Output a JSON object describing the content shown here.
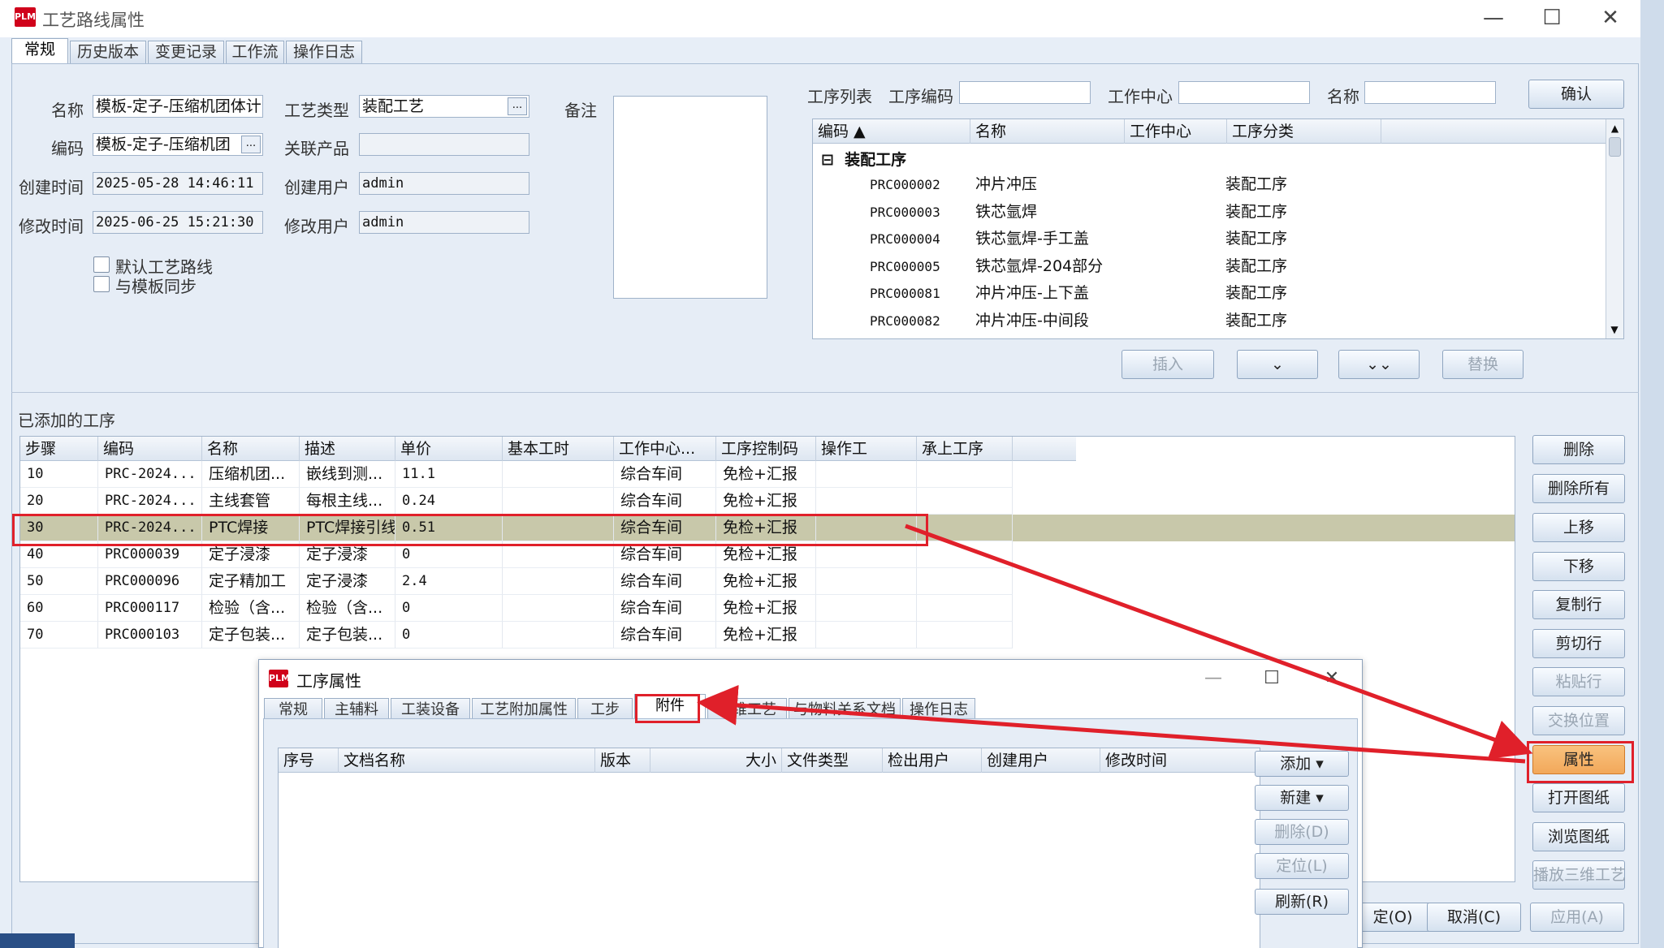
{
  "window": {
    "title": "工艺路线属性"
  },
  "tabs": [
    "常规",
    "历史版本",
    "变更记录",
    "工作流",
    "操作日志"
  ],
  "form": {
    "name_label": "名称",
    "name_value": "模板-定子-压缩机团体计",
    "code_label": "编码",
    "code_value": "模板-定子-压缩机团",
    "created_time_label": "创建时间",
    "created_time_value": "2025-05-28 14:46:11",
    "modified_time_label": "修改时间",
    "modified_time_value": "2025-06-25 15:21:30",
    "process_type_label": "工艺类型",
    "process_type_value": "装配工艺",
    "related_product_label": "关联产品",
    "related_product_value": "",
    "created_user_label": "创建用户",
    "created_user_value": "admin",
    "modified_user_label": "修改用户",
    "modified_user_value": "admin",
    "remark_label": "备注",
    "default_route_label": "默认工艺路线",
    "sync_template_label": "与模板同步"
  },
  "op_search": {
    "list_label": "工序列表",
    "code_label": "工序编码",
    "center_label": "工作中心",
    "name_label": "名称",
    "confirm": "确认"
  },
  "op_list": {
    "headers": [
      "编码",
      "名称",
      "工作中心",
      "工序分类"
    ],
    "group": "装配工序",
    "rows": [
      [
        "PRC000002",
        "冲片冲压",
        "",
        "装配工序"
      ],
      [
        "PRC000003",
        "铁芯氩焊",
        "",
        "装配工序"
      ],
      [
        "PRC000004",
        "铁芯氩焊-手工盖",
        "",
        "装配工序"
      ],
      [
        "PRC000005",
        "铁芯氩焊-204部分",
        "",
        "装配工序"
      ],
      [
        "PRC000081",
        "冲片冲压-上下盖",
        "",
        "装配工序"
      ],
      [
        "PRC000082",
        "冲片冲压-中间段",
        "",
        "装配工序"
      ]
    ],
    "insert": "插入",
    "replace": "替换"
  },
  "added": {
    "title": "已添加的工序",
    "headers": [
      "步骤",
      "编码",
      "名称",
      "描述",
      "单价",
      "基本工时",
      "工作中心...",
      "工序控制码",
      "操作工",
      "承上工序"
    ],
    "rows": [
      [
        "10",
        "PRC-2024...",
        "压缩机团...",
        "嵌线到测...",
        "11.1",
        "",
        "综合车间",
        "免检+汇报",
        "",
        ""
      ],
      [
        "20",
        "PRC-2024...",
        "主线套管",
        "每根主线...",
        "0.24",
        "",
        "综合车间",
        "免检+汇报",
        "",
        ""
      ],
      [
        "30",
        "PRC-2024...",
        "PTC焊接",
        "PTC焊接引线",
        "0.51",
        "",
        "综合车间",
        "免检+汇报",
        "",
        ""
      ],
      [
        "40",
        "PRC000039",
        "定子浸漆",
        "定子浸漆",
        "0",
        "",
        "综合车间",
        "免检+汇报",
        "",
        ""
      ],
      [
        "50",
        "PRC000096",
        "定子精加工",
        "定子浸漆",
        "2.4",
        "",
        "综合车间",
        "免检+汇报",
        "",
        ""
      ],
      [
        "60",
        "PRC000117",
        "检验（含...",
        "检验（含...",
        "0",
        "",
        "综合车间",
        "免检+汇报",
        "",
        ""
      ],
      [
        "70",
        "PRC000103",
        "定子包装...",
        "定子包装...",
        "0",
        "",
        "综合车间",
        "免检+汇报",
        "",
        ""
      ]
    ]
  },
  "side_buttons": [
    "删除",
    "删除所有",
    "上移",
    "下移",
    "复制行",
    "剪切行",
    "粘贴行",
    "交换位置",
    "属性",
    "打开图纸",
    "浏览图纸",
    "播放三维工艺"
  ],
  "bottom_buttons": {
    "ok": "定(O)",
    "cancel": "取消(C)",
    "apply": "应用(A)"
  },
  "sub_dialog": {
    "title": "工序属性",
    "tabs": [
      "常规",
      "主辅料",
      "工装设备",
      "工艺附加属性",
      "工步",
      "附件",
      "三维工艺",
      "与物料关系文档",
      "操作日志"
    ],
    "headers": [
      "序号",
      "文档名称",
      "版本",
      "大小",
      "文件类型",
      "检出用户",
      "创建用户",
      "修改时间"
    ],
    "buttons": [
      "添加 ▾",
      "新建 ▾",
      "删除(D)",
      "定位(L)",
      "刷新(R)"
    ]
  },
  "colors": {
    "highlight_row": "#c8c8aa",
    "annotation": "#e0202a",
    "properties_button": "#f2a85a"
  }
}
